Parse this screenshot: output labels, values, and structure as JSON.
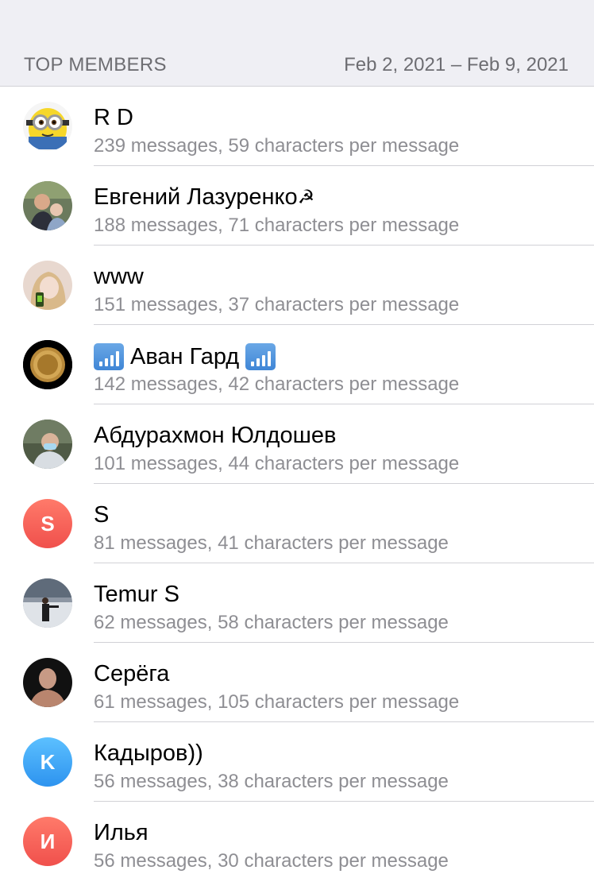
{
  "header": {
    "title": "TOP MEMBERS",
    "date_range": "Feb 2, 2021 – Feb 9, 2021"
  },
  "members": [
    {
      "name": "R D",
      "stats": "239 messages, 59 characters per message",
      "avatar": "minion-avatar"
    },
    {
      "name": "Евгений Лазуренко",
      "stats": "188 messages, 71 characters per message",
      "avatar": "photo-avatar",
      "suffix_icon": "☭"
    },
    {
      "name": "www",
      "stats": "151 messages, 37 characters per message",
      "avatar": "photo-avatar"
    },
    {
      "name": "Аван Гард",
      "stats": "142 messages, 42 characters per message",
      "avatar": "coin-avatar",
      "side_icons": "signal-strength-icon"
    },
    {
      "name": "Абдурахмон Юлдошев",
      "stats": "101 messages, 44 characters per message",
      "avatar": "photo-avatar"
    },
    {
      "name": "S",
      "stats": "81 messages, 41 characters per message",
      "avatar_letter": "S",
      "avatar_color": "#f0594f"
    },
    {
      "name": "Temur S",
      "stats": "62 messages, 58 characters per message",
      "avatar": "photo-avatar"
    },
    {
      "name": "Серёга",
      "stats": "61 messages, 105 characters per message",
      "avatar": "photo-avatar"
    },
    {
      "name": "Кадыров))",
      "stats": "56 messages, 38 characters per message",
      "avatar_letter": "K",
      "avatar_color": "#3d9ff0"
    },
    {
      "name": "Илья",
      "stats": "56 messages, 30 characters per message",
      "avatar_letter": "И",
      "avatar_color": "#f0594f"
    }
  ]
}
